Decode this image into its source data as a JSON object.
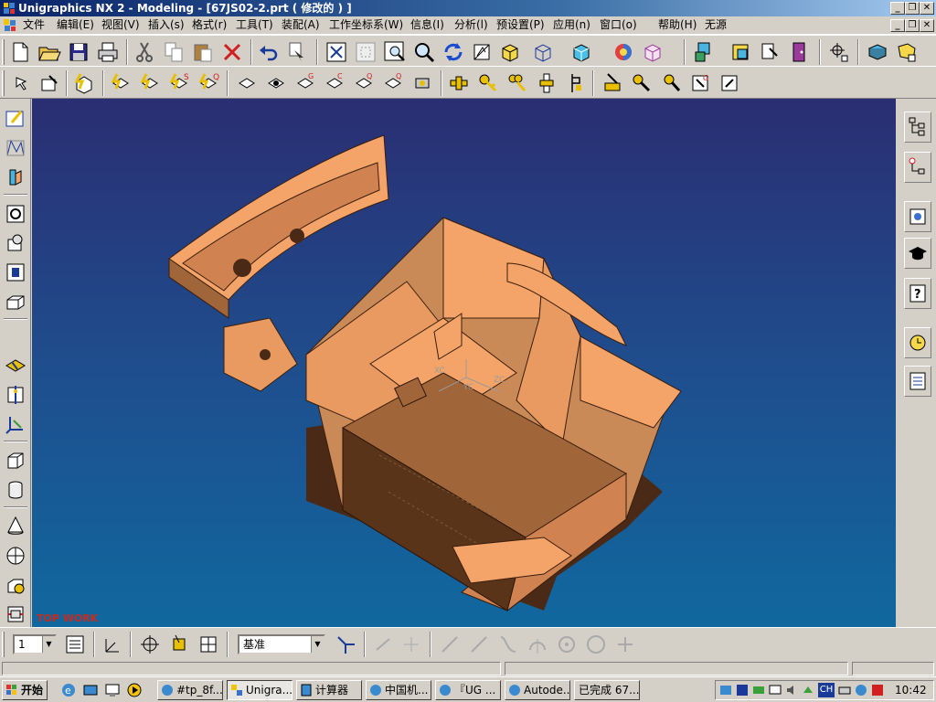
{
  "window": {
    "title": "Unigraphics NX 2 - Modeling - [67JS02-2.prt ( 修改的 ) ]",
    "minimize": "_",
    "restore": "❐",
    "close": "✕"
  },
  "menu": {
    "items": [
      {
        "label": "文件"
      },
      {
        "label": "编辑(E)"
      },
      {
        "label": "视图(V)"
      },
      {
        "label": "插入(s)"
      },
      {
        "label": "格式(r)"
      },
      {
        "label": "工具(T)"
      },
      {
        "label": "装配(A)"
      },
      {
        "label": "工作坐标系(W)"
      },
      {
        "label": "信息(I)"
      },
      {
        "label": "分析(l)"
      },
      {
        "label": "预设置(P)"
      },
      {
        "label": "应用(n)"
      },
      {
        "label": "窗口(o)"
      },
      {
        "label": "帮助(H)"
      },
      {
        "label": "无源"
      }
    ]
  },
  "viewport": {
    "watermark": "TOP WORK",
    "triad": {
      "xc": "XC",
      "yc": "YC",
      "zc": "ZC"
    },
    "colors": {
      "model": "#f4a468",
      "model_shadow": "#4a2a16",
      "bg_top": "#2a2e72",
      "bg_bottom": "#10689f"
    }
  },
  "bottom_toolbar": {
    "layer_value": "1",
    "snap_mode": "基准"
  },
  "taskbar": {
    "start": "开始",
    "tasks": [
      {
        "label": "#tp_8f..."
      },
      {
        "label": "Unigra..."
      },
      {
        "label": "计算器"
      },
      {
        "label": "中国机..."
      },
      {
        "label": "『UG ..."
      },
      {
        "label": "Autode..."
      },
      {
        "label": "已完成 67..."
      }
    ],
    "tray_text": "CH",
    "clock": "10:42"
  },
  "icons": [
    "new-icon",
    "open-icon",
    "save-icon",
    "print-icon",
    "cut-icon",
    "copy-icon",
    "paste-icon",
    "delete-icon",
    "undo-icon",
    "fit-icon",
    "zoom-icon",
    "rotate-icon",
    "shading-icon",
    "layer-icon",
    "help-icon",
    "clock-icon"
  ]
}
